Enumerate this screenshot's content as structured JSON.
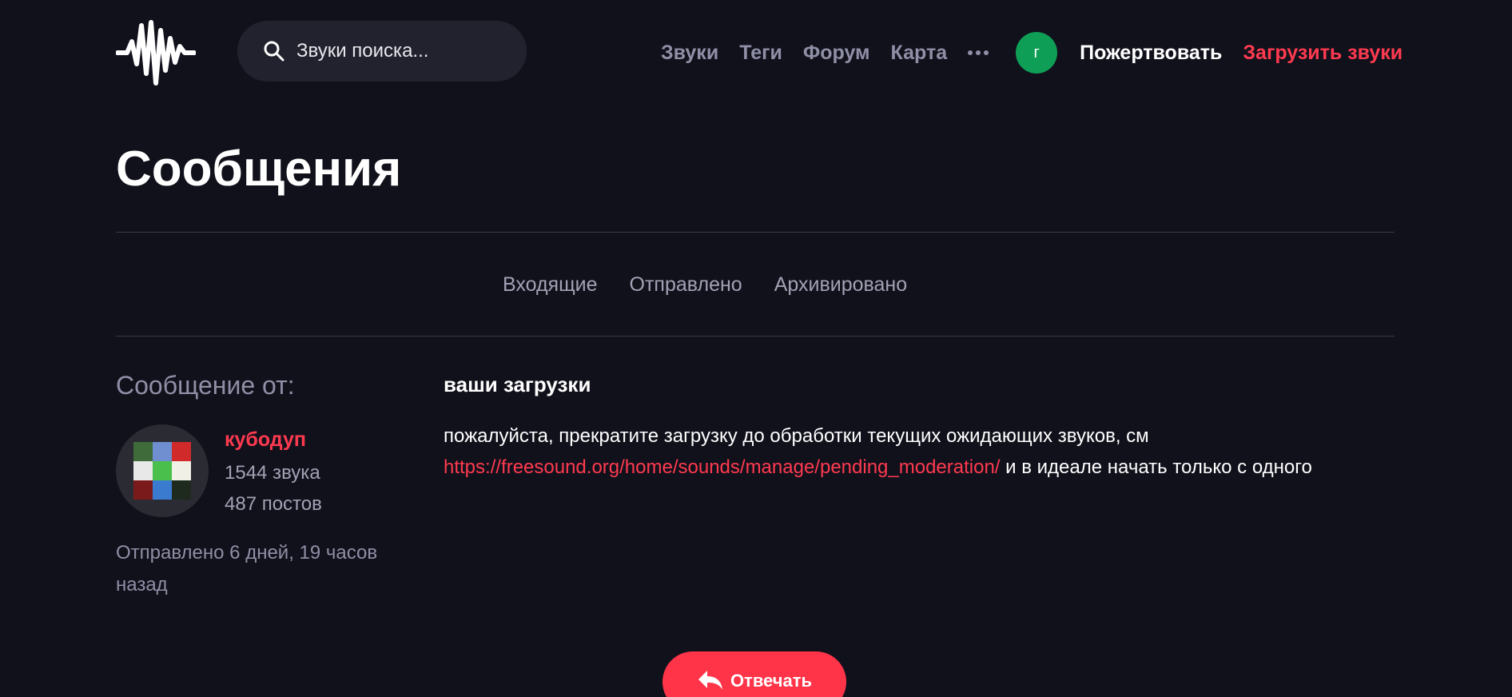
{
  "header": {
    "logo_icon": "freesound-waveform-logo",
    "search": {
      "placeholder": "Звуки поиска...",
      "icon": "search-icon"
    },
    "nav": {
      "sounds": "Звуки",
      "tags": "Теги",
      "forum": "Форум",
      "map": "Карта",
      "more_icon": "more-dots-icon"
    },
    "user_avatar_letter": "г",
    "user_avatar_color": "#0e9e55",
    "donate": "Пожертвовать",
    "upload": "Загрузить звуки",
    "accent_color": "#ff3a4f"
  },
  "page": {
    "title": "Сообщения",
    "tabs": {
      "inbox": "Входящие",
      "sent": "Отправлено",
      "archived": "Архивировано"
    }
  },
  "message": {
    "from_label": "Сообщение от:",
    "sender": {
      "name": "кубодуп",
      "sounds": "1544 звука",
      "posts": "487 постов"
    },
    "sent_time": "Отправлено 6 дней, 19 часов назад",
    "subject": "ваши загрузки",
    "body_before": "пожалуйста, прекратите загрузку до обработки текущих ожидающих звуков, см",
    "body_link": "https://freesound.org/home/sounds/manage/pending_moderation/",
    "body_after": "и в идеале начать только с одного",
    "reply_label": "Отвечать",
    "reply_icon": "reply-arrow-icon"
  }
}
